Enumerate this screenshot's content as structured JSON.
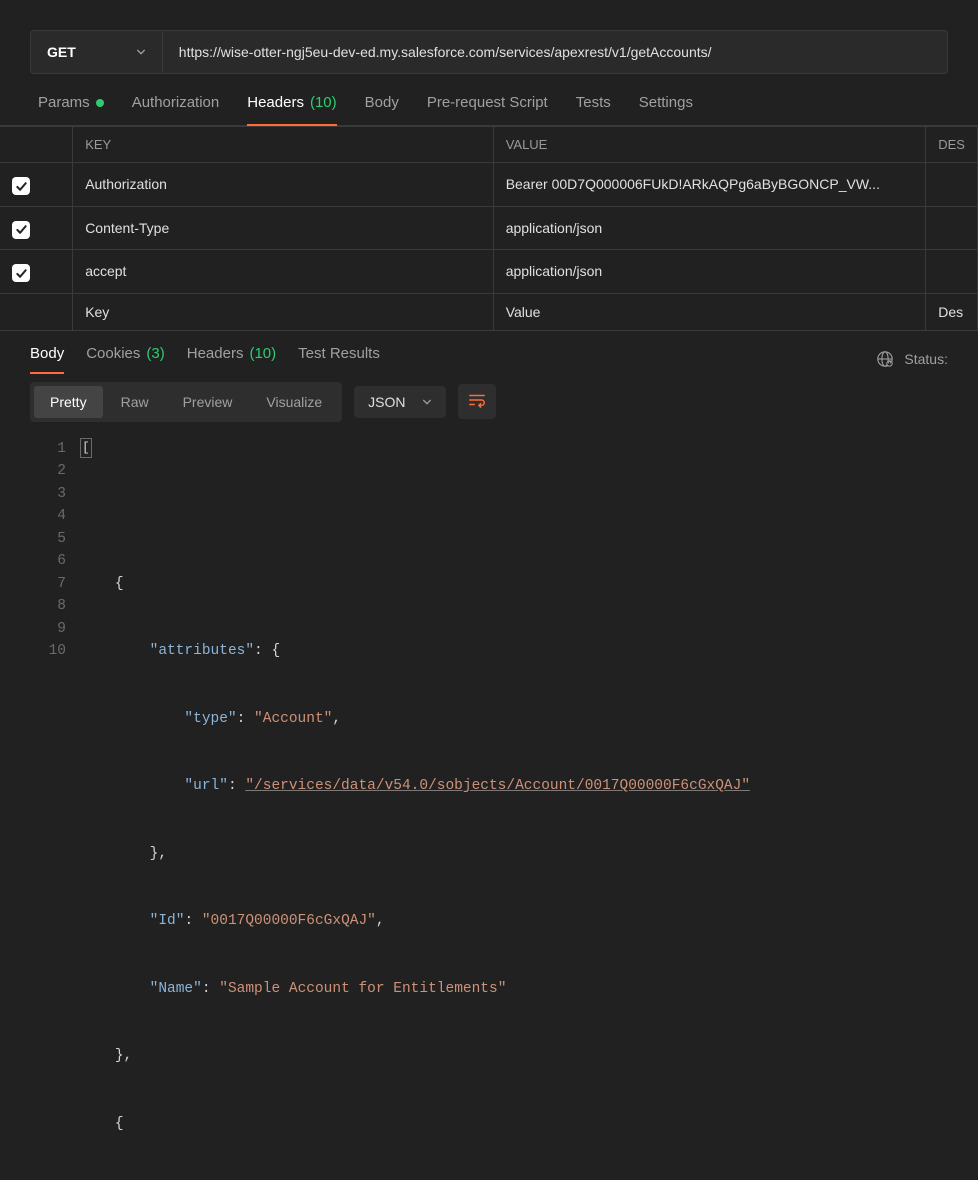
{
  "request": {
    "method": "GET",
    "url": "https://wise-otter-ngj5eu-dev-ed.my.salesforce.com/services/apexrest/v1/getAccounts/"
  },
  "req_tabs": {
    "params": {
      "label": "Params",
      "has_dot": true
    },
    "authorization": {
      "label": "Authorization"
    },
    "headers": {
      "label": "Headers",
      "count": "(10)"
    },
    "body": {
      "label": "Body"
    },
    "prerequest": {
      "label": "Pre-request Script"
    },
    "tests": {
      "label": "Tests"
    },
    "settings": {
      "label": "Settings"
    }
  },
  "headers_table": {
    "cols": {
      "key": "KEY",
      "value": "VALUE",
      "desc": "DES"
    },
    "rows": [
      {
        "key": "Authorization",
        "value": "Bearer 00D7Q000006FUkD!ARkAQPg6aByBGONCP_VW..."
      },
      {
        "key": "Content-Type",
        "value": "application/json"
      },
      {
        "key": "accept",
        "value": "application/json"
      }
    ],
    "placeholders": {
      "key": "Key",
      "value": "Value",
      "desc": "Des"
    }
  },
  "res_tabs": {
    "body": {
      "label": "Body"
    },
    "cookies": {
      "label": "Cookies",
      "count": "(3)"
    },
    "headers": {
      "label": "Headers",
      "count": "(10)"
    },
    "test_results": {
      "label": "Test Results"
    }
  },
  "status_label": "Status:",
  "view_tabs": {
    "pretty": "Pretty",
    "raw": "Raw",
    "preview": "Preview",
    "visualize": "Visualize"
  },
  "format_select": "JSON",
  "chart_data": {
    "type": "table",
    "note": "response body JSON content shown in editor",
    "response": [
      {
        "attributes": {
          "type": "Account",
          "url": "/services/data/v54.0/sobjects/Account/0017Q00000F6cGxQAJ"
        },
        "Id": "0017Q00000F6cGxQAJ",
        "Name": "Sample Account for Entitlements"
      }
    ]
  },
  "code": {
    "l2": "{",
    "l3k": "\"attributes\"",
    "l3r": ": {",
    "l4k": "\"type\"",
    "l4v": "\"Account\"",
    "l5k": "\"url\"",
    "l5v": "\"/services/data/v54.0/sobjects/Account/0017Q00000F6cGxQAJ\"",
    "l6": "},",
    "l7k": "\"Id\"",
    "l7v": "\"0017Q00000F6cGxQAJ\"",
    "l8k": "\"Name\"",
    "l8v": "\"Sample Account for Entitlements\"",
    "l9": "},",
    "l10": "{"
  },
  "line_numbers": [
    "1",
    "2",
    "3",
    "4",
    "5",
    "6",
    "7",
    "8",
    "9",
    "10"
  ]
}
